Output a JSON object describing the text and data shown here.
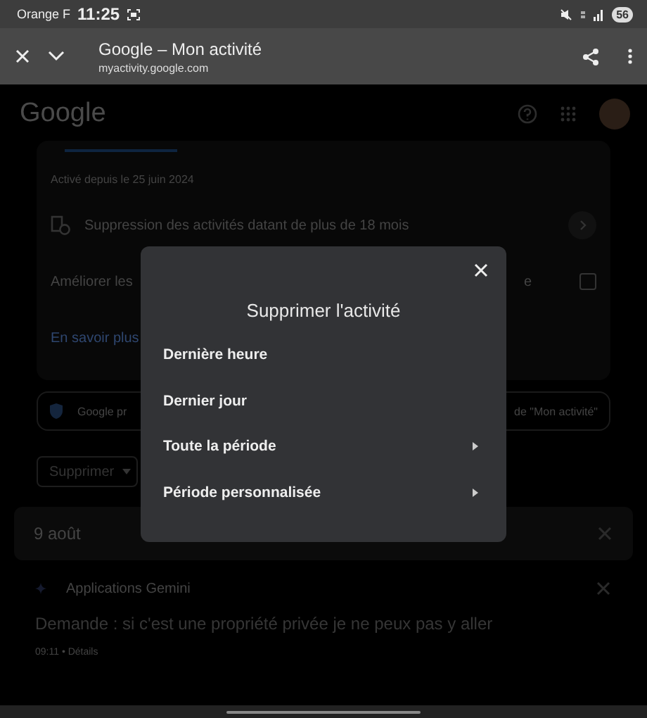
{
  "status_bar": {
    "carrier": "Orange F",
    "time": "11:25",
    "battery": "56"
  },
  "browser_bar": {
    "title": "Google – Mon activité",
    "url": "myactivity.google.com"
  },
  "page": {
    "logo": "Google",
    "activity_since": "Activé depuis le 25 juin 2024",
    "auto_delete": "Suppression des activités datant de plus de 18 mois",
    "improve_text": "Améliorer les",
    "improve_tail": "e",
    "improve_checked": false,
    "learn_more": "En savoir plus",
    "notice_start": "Google pr",
    "notice_end": "de \"Mon activité\"",
    "delete_button": "Supprimer"
  },
  "day": {
    "title": "9 août"
  },
  "entry": {
    "app": "Applications Gemini",
    "query": "Demande : si c'est une propriété privée je ne peux pas y aller",
    "meta": "09:11 • Détails"
  },
  "dialog": {
    "title": "Supprimer l'activité",
    "options": [
      {
        "label": "Dernière heure",
        "has_submenu": false
      },
      {
        "label": "Dernier jour",
        "has_submenu": false
      },
      {
        "label": "Toute la période",
        "has_submenu": true
      },
      {
        "label": "Période personnalisée",
        "has_submenu": true
      }
    ]
  }
}
